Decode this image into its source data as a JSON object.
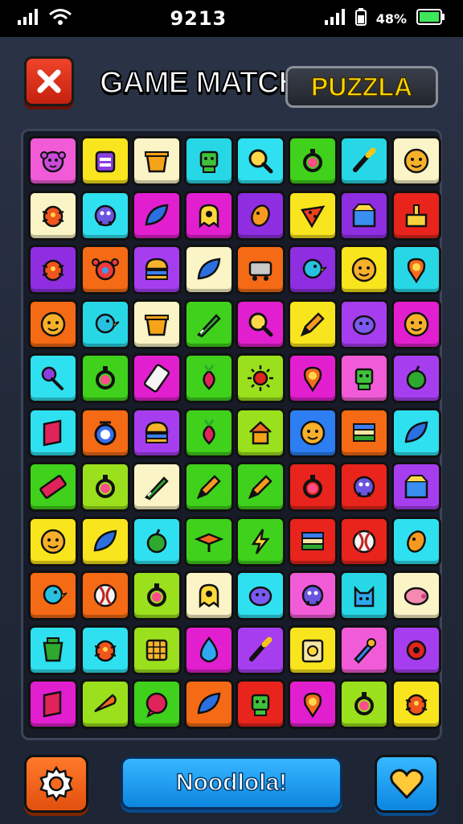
{
  "status_bar": {
    "time": "9213",
    "battery_pct": "48%"
  },
  "header": {
    "title": "GAME MATCH",
    "badge": "PUZZLA"
  },
  "footer": {
    "play_label": "Noodlola!"
  },
  "colors": {
    "pink": "#f25bd8",
    "yellow": "#f8e51d",
    "cream": "#fbf4c6",
    "teal": "#27d7e6",
    "cyan": "#2fe0f0",
    "green": "#3fd11b",
    "magenta": "#e21fcf",
    "red": "#e8241c",
    "orange": "#f56a14",
    "purple": "#8e2ee0",
    "violet": "#a63ef0",
    "lime": "#9be01c",
    "blue": "#2c7ef2"
  },
  "board": {
    "rows": [
      [
        {
          "color": "pink",
          "icon": "monkey-icon"
        },
        {
          "color": "yellow",
          "icon": "backpack-icon"
        },
        {
          "color": "cream",
          "icon": "pot-icon"
        },
        {
          "color": "teal",
          "icon": "robot-icon"
        },
        {
          "color": "cyan",
          "icon": "magnifier-icon"
        },
        {
          "color": "green",
          "icon": "gem-ring-icon"
        },
        {
          "color": "teal",
          "icon": "brush-icon"
        },
        {
          "color": "cream",
          "icon": "face-icon"
        }
      ],
      [
        {
          "color": "cream",
          "icon": "bug-icon"
        },
        {
          "color": "cyan",
          "icon": "monster-icon"
        },
        {
          "color": "magenta",
          "icon": "leaf-icon"
        },
        {
          "color": "magenta",
          "icon": "ghost-icon"
        },
        {
          "color": "purple",
          "icon": "bean-icon"
        },
        {
          "color": "yellow",
          "icon": "pizza-icon"
        },
        {
          "color": "purple",
          "icon": "box-icon"
        },
        {
          "color": "red",
          "icon": "cake-icon"
        }
      ],
      [
        {
          "color": "purple",
          "icon": "bug-icon"
        },
        {
          "color": "orange",
          "icon": "crab-icon"
        },
        {
          "color": "violet",
          "icon": "burger-icon"
        },
        {
          "color": "cream",
          "icon": "leaf-icon"
        },
        {
          "color": "orange",
          "icon": "cart-icon"
        },
        {
          "color": "purple",
          "icon": "bird-icon"
        },
        {
          "color": "yellow",
          "icon": "face-icon"
        },
        {
          "color": "teal",
          "icon": "pin-icon"
        }
      ],
      [
        {
          "color": "orange",
          "icon": "face-icon"
        },
        {
          "color": "teal",
          "icon": "bird-icon"
        },
        {
          "color": "cream",
          "icon": "pot-icon"
        },
        {
          "color": "green",
          "icon": "knife-icon"
        },
        {
          "color": "magenta",
          "icon": "magnifier-icon"
        },
        {
          "color": "yellow",
          "icon": "pencil-icon"
        },
        {
          "color": "violet",
          "icon": "blob-icon"
        },
        {
          "color": "magenta",
          "icon": "face-icon"
        }
      ],
      [
        {
          "color": "cyan",
          "icon": "key-icon"
        },
        {
          "color": "green",
          "icon": "gem-ring-icon"
        },
        {
          "color": "magenta",
          "icon": "phone-icon"
        },
        {
          "color": "green",
          "icon": "radish-icon"
        },
        {
          "color": "lime",
          "icon": "sun-icon"
        },
        {
          "color": "magenta",
          "icon": "pin-icon"
        },
        {
          "color": "pink",
          "icon": "robot-icon"
        },
        {
          "color": "violet",
          "icon": "apple-icon"
        }
      ],
      [
        {
          "color": "cyan",
          "icon": "book-icon"
        },
        {
          "color": "orange",
          "icon": "clock-icon"
        },
        {
          "color": "violet",
          "icon": "burger-icon"
        },
        {
          "color": "green",
          "icon": "radish-icon"
        },
        {
          "color": "lime",
          "icon": "house-icon"
        },
        {
          "color": "blue",
          "icon": "face-icon"
        },
        {
          "color": "orange",
          "icon": "stack-icon"
        },
        {
          "color": "cyan",
          "icon": "leaf-icon"
        }
      ],
      [
        {
          "color": "green",
          "icon": "ruler-icon"
        },
        {
          "color": "lime",
          "icon": "gem-ring-icon"
        },
        {
          "color": "cream",
          "icon": "knife-icon"
        },
        {
          "color": "green",
          "icon": "pencil-icon"
        },
        {
          "color": "green",
          "icon": "pencil-icon"
        },
        {
          "color": "red",
          "icon": "gem-ring-icon"
        },
        {
          "color": "red",
          "icon": "monster-icon"
        },
        {
          "color": "violet",
          "icon": "box-icon"
        }
      ],
      [
        {
          "color": "yellow",
          "icon": "face-icon"
        },
        {
          "color": "yellow",
          "icon": "leaf-icon"
        },
        {
          "color": "cyan",
          "icon": "apple-icon"
        },
        {
          "color": "green",
          "icon": "spinner-icon"
        },
        {
          "color": "green",
          "icon": "bolt-icon"
        },
        {
          "color": "red",
          "icon": "stack-icon"
        },
        {
          "color": "red",
          "icon": "ball-icon"
        },
        {
          "color": "cyan",
          "icon": "bean-icon"
        }
      ],
      [
        {
          "color": "orange",
          "icon": "bird-icon"
        },
        {
          "color": "orange",
          "icon": "ball-icon"
        },
        {
          "color": "lime",
          "icon": "gem-ring-icon"
        },
        {
          "color": "cream",
          "icon": "ghost-icon"
        },
        {
          "color": "cyan",
          "icon": "blob-icon"
        },
        {
          "color": "pink",
          "icon": "monster-icon"
        },
        {
          "color": "teal",
          "icon": "cat-icon"
        },
        {
          "color": "cream",
          "icon": "pig-icon"
        }
      ],
      [
        {
          "color": "cyan",
          "icon": "bucket-icon"
        },
        {
          "color": "cyan",
          "icon": "bug-icon"
        },
        {
          "color": "lime",
          "icon": "grid-icon"
        },
        {
          "color": "magenta",
          "icon": "drop-icon"
        },
        {
          "color": "violet",
          "icon": "brush-icon"
        },
        {
          "color": "yellow",
          "icon": "radio-icon"
        },
        {
          "color": "pink",
          "icon": "tool-icon"
        },
        {
          "color": "violet",
          "icon": "gear-icon"
        }
      ],
      [
        {
          "color": "magenta",
          "icon": "book-icon"
        },
        {
          "color": "lime",
          "icon": "carrot-icon"
        },
        {
          "color": "green",
          "icon": "bubble-icon"
        },
        {
          "color": "orange",
          "icon": "leaf-icon"
        },
        {
          "color": "red",
          "icon": "robot-icon"
        },
        {
          "color": "magenta",
          "icon": "pin-icon"
        },
        {
          "color": "lime",
          "icon": "gem-ring-icon"
        },
        {
          "color": "yellow",
          "icon": "bug-icon"
        }
      ]
    ]
  }
}
